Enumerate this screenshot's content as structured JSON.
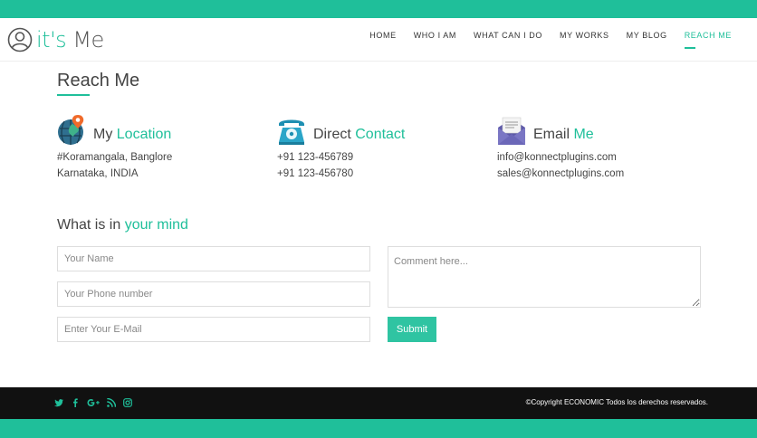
{
  "colors": {
    "accent": "#1fbf9a",
    "footer_bg": "#111111"
  },
  "brand": {
    "logo_text_a": "it's",
    "logo_text_b": "Me",
    "logo_icon": "user-icon"
  },
  "nav": {
    "items": [
      {
        "label": "HOME"
      },
      {
        "label": "WHO I AM"
      },
      {
        "label": "WHAT CAN I DO"
      },
      {
        "label": "MY WORKS"
      },
      {
        "label": "MY BLOG"
      },
      {
        "label": "REACH ME",
        "active": true
      }
    ]
  },
  "section": {
    "title": "Reach Me"
  },
  "contacts": {
    "location": {
      "icon": "location-globe-icon",
      "title_a": "My",
      "title_b": "Location",
      "lines": [
        "#Koramangala, Banglore",
        "Karnataka, INDIA"
      ]
    },
    "phone": {
      "icon": "telephone-icon",
      "title_a": "Direct",
      "title_b": "Contact",
      "lines": [
        "+91 123-456789",
        "+91 123-456780"
      ]
    },
    "email": {
      "icon": "envelope-icon",
      "title_a": "Email",
      "title_b": "Me",
      "lines": [
        "info@konnectplugins.com",
        "sales@konnectplugins.com"
      ]
    }
  },
  "form": {
    "title_a": "What is in",
    "title_b": "your mind",
    "name_placeholder": "Your Name",
    "phone_placeholder": "Your Phone number",
    "email_placeholder": "Enter Your E-Mail",
    "comment_placeholder": "Comment here...",
    "submit_label": "Submit"
  },
  "footer": {
    "social_icons": [
      "twitter-icon",
      "facebook-icon",
      "google-plus-icon",
      "rss-icon",
      "instagram-icon"
    ],
    "copyright": "©Copyright ECONOMIC Todos los derechos reservados."
  }
}
